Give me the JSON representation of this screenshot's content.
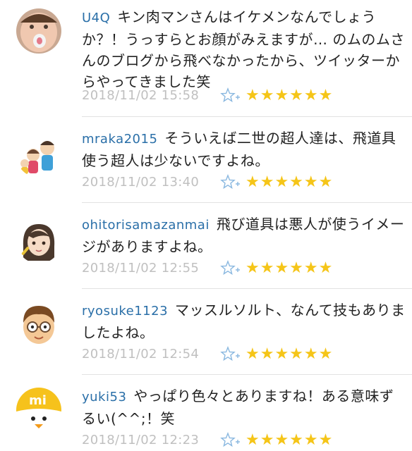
{
  "comments": [
    {
      "username": "U4Q",
      "text": "キン肉マンさんはイケメンなんでしょうか？！うっすらとお顔がみえますが… のムのムさんのブログから飛べなかったから、ツイッターからやってきました笑",
      "timestamp": "2018/11/02 15:58",
      "stars": "★★★★★★",
      "avatar_icon": "baby-avatar-icon"
    },
    {
      "username": "mraka2015",
      "text": "そういえば二世の超人達は、飛道具使う超人は少ないですよね。",
      "timestamp": "2018/11/02 13:40",
      "stars": "★★★★★★",
      "avatar_icon": "family-avatar-icon"
    },
    {
      "username": "ohitorisamazanmai",
      "text": "飛び道具は悪人が使うイメージがありますよね。",
      "timestamp": "2018/11/02 12:55",
      "stars": "★★★★★★",
      "avatar_icon": "woman-avatar-icon"
    },
    {
      "username": "ryosuke1123",
      "text": "マッスルソルト、なんて技もありましたよね。",
      "timestamp": "2018/11/02 12:54",
      "stars": "★★★★★★",
      "avatar_icon": "man-glasses-avatar-icon"
    },
    {
      "username": "yuki53",
      "text": "やっぱり色々とありますね！ある意味ずるい(^^;！笑",
      "timestamp": "2018/11/02 12:23",
      "stars": "★★★★★★",
      "avatar_icon": "mi-duck-avatar-icon"
    }
  ],
  "colors": {
    "username": "#2a6fa8",
    "text": "#222222",
    "timestamp": "#c0c0c0",
    "star": "#f5c518",
    "fav_icon": "#8ab8e0"
  }
}
